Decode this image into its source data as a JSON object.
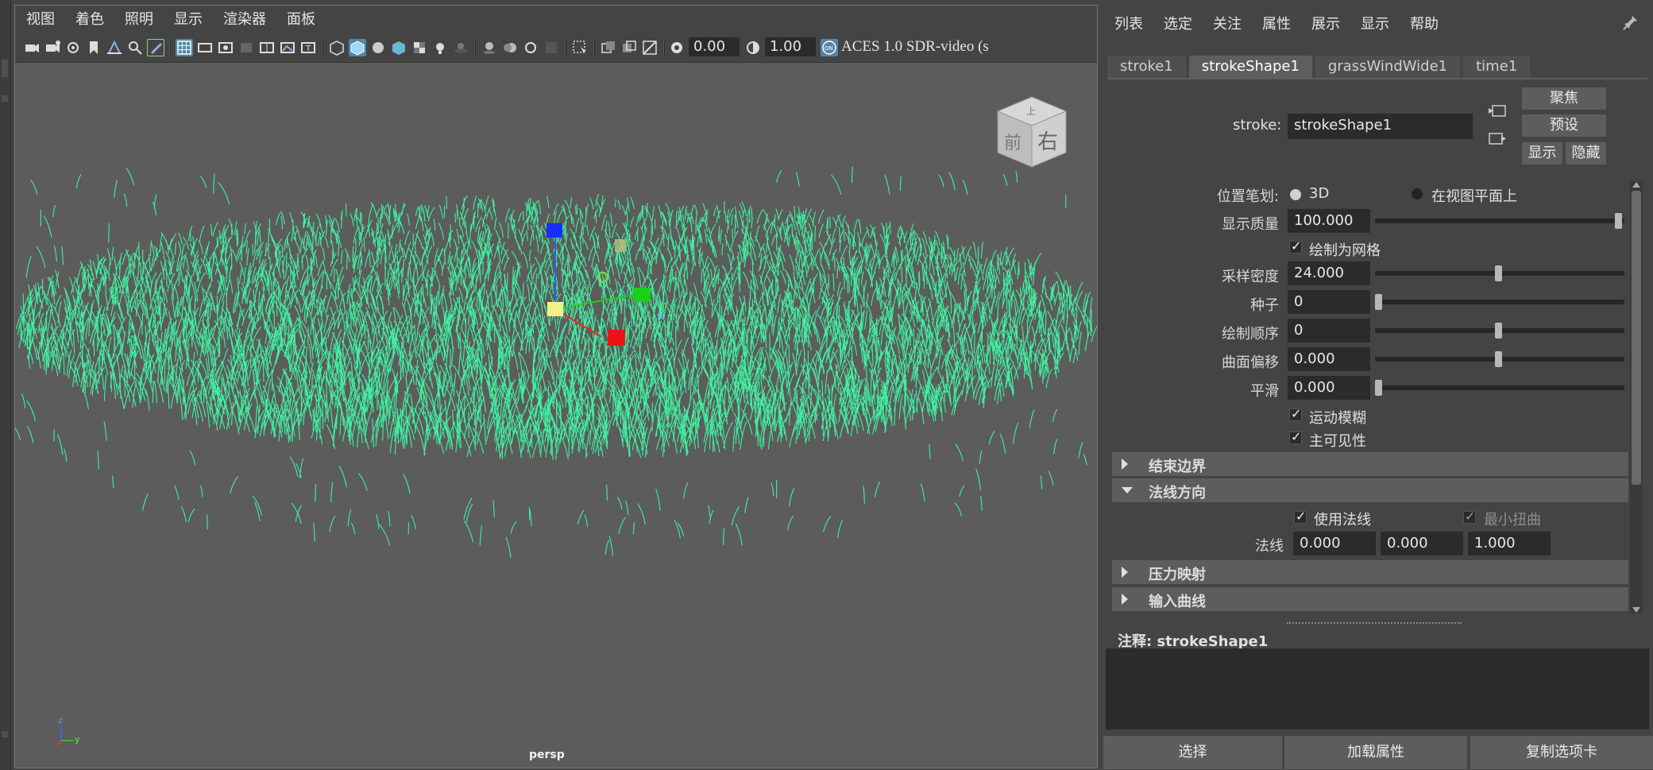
{
  "viewport": {
    "menu": [
      "视图",
      "着色",
      "照明",
      "显示",
      "渲染器",
      "面板"
    ],
    "toolbar": {
      "exposure_value": "0.00",
      "gamma_value": "1.00",
      "color_space": "ACES 1.0 SDR-video (s"
    },
    "camera_label": "persp",
    "viewcube": {
      "top": "上",
      "front": "前",
      "right": "右"
    },
    "axis": {
      "z": "z",
      "y": "y"
    },
    "grass_color": "#3ff0a0"
  },
  "attribute_editor": {
    "menu": [
      "列表",
      "选定",
      "关注",
      "属性",
      "展示",
      "显示",
      "帮助"
    ],
    "tabs": [
      "stroke1",
      "strokeShape1",
      "grassWindWide1",
      "time1"
    ],
    "active_tab": "strokeShape1",
    "stroke_label": "stroke:",
    "stroke_value": "strokeShape1",
    "buttons": {
      "focus": "聚焦",
      "preset": "预设",
      "show": "显示",
      "hide": "隐藏"
    },
    "attrs": {
      "position_stroke_label": "位置笔划:",
      "option_3d": "3D",
      "option_view_plane": "在视图平面上",
      "display_quality_label": "显示质量",
      "display_quality_value": "100.000",
      "draw_as_mesh_label": "绘制为网格",
      "sample_density_label": "采样密度",
      "sample_density_value": "24.000",
      "seed_label": "种子",
      "seed_value": "0",
      "draw_order_label": "绘制顺序",
      "draw_order_value": "0",
      "surface_offset_label": "曲面偏移",
      "surface_offset_value": "0.000",
      "smooth_label": "平滑",
      "smooth_value": "0.000",
      "motion_blur_label": "运动模糊",
      "primary_visibility_label": "主可见性"
    },
    "sections": {
      "end_bounds": "结束边界",
      "normal_direction": "法线方向",
      "pressure_mapping": "压力映射",
      "input_curves": "输入曲线"
    },
    "normal": {
      "use_normal_label": "使用法线",
      "min_twist_label": "最小扭曲",
      "normal_label": "法线",
      "x": "0.000",
      "y": "0.000",
      "z": "1.000"
    },
    "notes_label": "注释:  strokeShape1",
    "bottom_buttons": {
      "select": "选择",
      "load_attrs": "加载属性",
      "copy_tab": "复制选项卡"
    }
  }
}
